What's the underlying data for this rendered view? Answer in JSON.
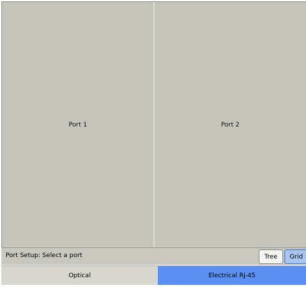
{
  "ports": [
    {
      "label": "Port 1"
    },
    {
      "label": "Port 2"
    }
  ],
  "status": {
    "text": "Port Setup: Select a port"
  },
  "view_toggle": {
    "tree_label": "Tree",
    "grid_label": "Grid",
    "selected": "Grid"
  },
  "tabs": [
    {
      "label": "Optical",
      "selected": false
    },
    {
      "label": "Electrical RJ-45",
      "selected": true
    }
  ],
  "colors": {
    "panel_bg": "#c6c5bc",
    "selected_tab": "#5b8ff2",
    "unselected_tab": "#d6d5ce",
    "grid_button_selected": "#a8c4f0"
  }
}
